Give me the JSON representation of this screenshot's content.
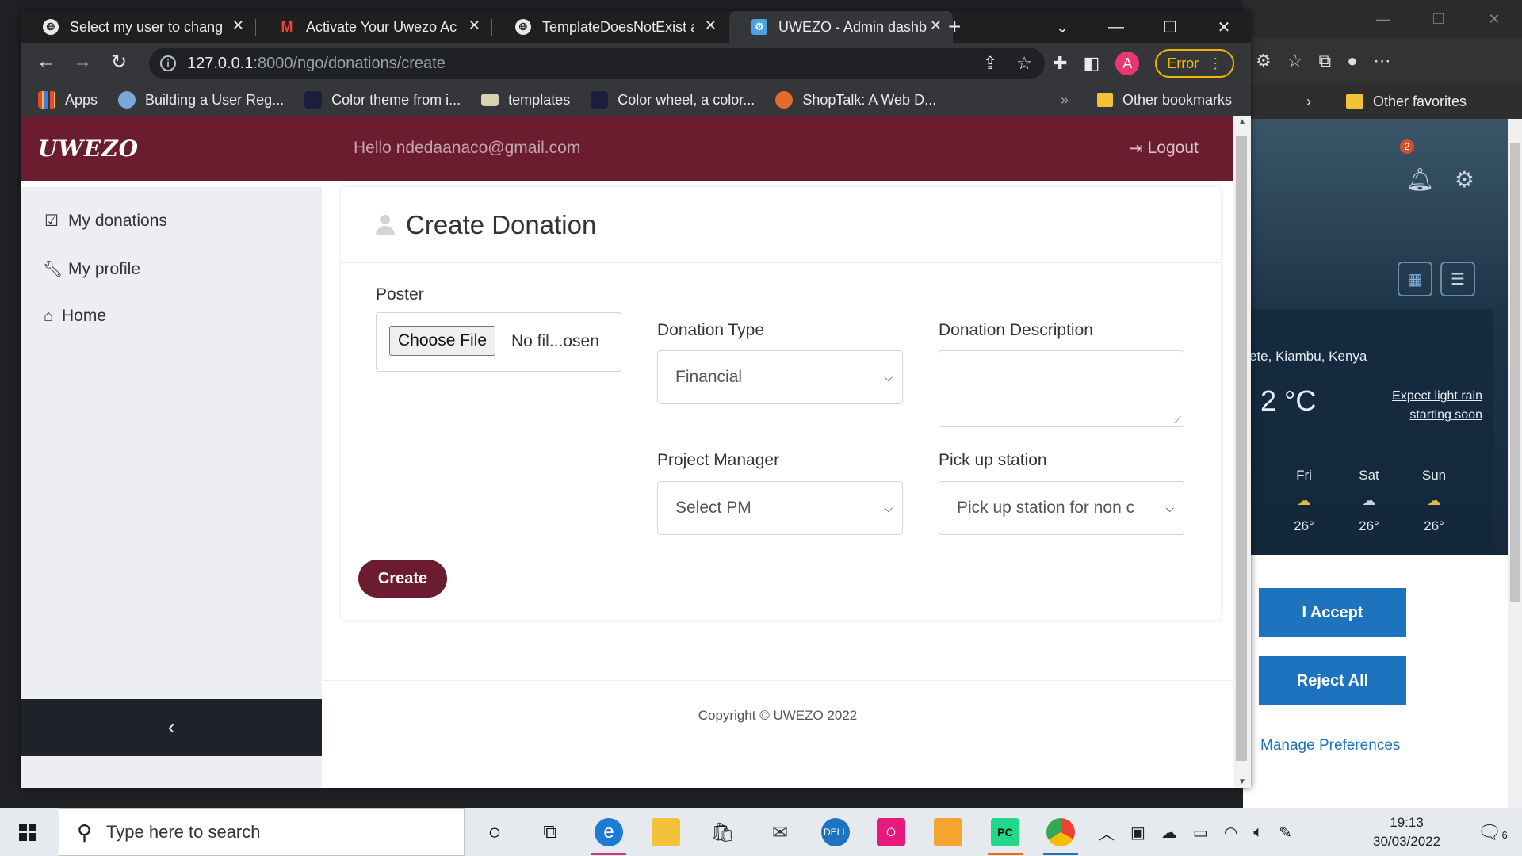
{
  "browser": {
    "tabs": [
      {
        "title": "Select my user to chang",
        "icon": "globe-icon"
      },
      {
        "title": "Activate Your Uwezo Ac",
        "icon": "gmail-icon"
      },
      {
        "title": "TemplateDoesNotExist a",
        "icon": "globe-icon"
      },
      {
        "title": "UWEZO - Admin dashb",
        "icon": "site-icon",
        "active": true
      }
    ],
    "url_host": "127.0.0.1",
    "url_path": ":8000/ngo/donations/create",
    "profile_initial": "A",
    "error_label": "Error",
    "bookmarks": [
      {
        "label": "Apps",
        "icon": "apps-grid-icon",
        "color": "#e8453c"
      },
      {
        "label": "Building a User Reg...",
        "icon": "site-icon",
        "color": "#7aa7d8"
      },
      {
        "label": "Color theme from i...",
        "icon": "adobe-color-icon",
        "color": "#1b1f3b"
      },
      {
        "label": "templates",
        "icon": "image-icon",
        "color": "#d8d2b0"
      },
      {
        "label": "Color wheel, a color...",
        "icon": "adobe-color-icon",
        "color": "#1b1f3b"
      },
      {
        "label": "ShopTalk: A Web D...",
        "icon": "shoptalk-icon",
        "color": "#e36b2c"
      }
    ],
    "bookmarks_more": "»",
    "other_bookmarks": "Other bookmarks"
  },
  "app": {
    "brand": "UWEZO",
    "greeting": "Hello ndedaanaco@gmail.com",
    "logout": "Logout",
    "sidebar": [
      {
        "label": "My donations",
        "icon": "calendar-check-icon"
      },
      {
        "label": "My profile",
        "icon": "wrench-icon"
      },
      {
        "label": "Home",
        "icon": "home-icon"
      }
    ],
    "sidebar_toggle": "‹",
    "form": {
      "title": "Create Donation",
      "poster_label": "Poster",
      "file_button": "Choose File",
      "file_status": "No fil...osen",
      "donation_type_label": "Donation Type",
      "donation_type_value": "Financial",
      "description_label": "Donation Description",
      "description_value": "",
      "pm_label": "Project Manager",
      "pm_value": "Select PM",
      "pickup_label": "Pick up station",
      "pickup_value": "Pick up station for non c",
      "submit": "Create"
    },
    "footer": "Copyright © UWEZO 2022"
  },
  "background_window": {
    "other_favorites": "Other favorites",
    "notification_count": "2",
    "weather_location": "ete, Kiambu, Kenya",
    "weather_temp": "2 °C",
    "weather_alert_line1": "Expect light rain",
    "weather_alert_line2": "starting soon",
    "days": [
      "Fri",
      "Sat",
      "Sun"
    ],
    "day_temps": [
      "26°",
      "26°",
      "26°"
    ],
    "accept": "I Accept",
    "reject": "Reject All",
    "manage": "Manage Preferences"
  },
  "taskbar": {
    "search_placeholder": "Type here to search",
    "time": "19:13",
    "date": "30/03/2022",
    "notification_count": "6"
  }
}
